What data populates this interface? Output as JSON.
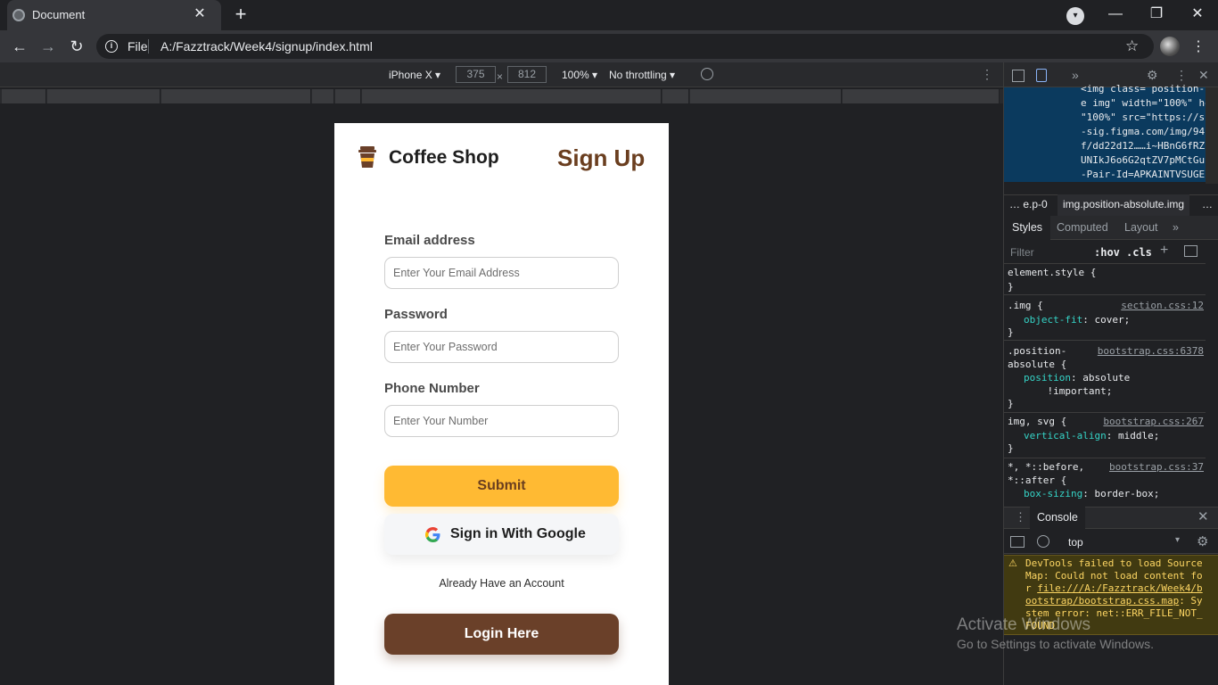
{
  "browser": {
    "tab_title": "Document",
    "tab_close": "✕",
    "new_tab": "+",
    "window_controls": {
      "minimize": "—",
      "restore": "❐",
      "close": "✕"
    },
    "address": {
      "scheme": "File",
      "url": "A:/Fazztrack/Week4/signup/index.html"
    },
    "back": "←",
    "forward": "→",
    "reload": "↻",
    "star": "☆",
    "menu": "⋮"
  },
  "device_toolbar": {
    "device": "iPhone X ▾",
    "width": "375",
    "times": "×",
    "height": "812",
    "zoom": "100% ▾",
    "throttling": "No throttling ▾",
    "menu": "⋮"
  },
  "page": {
    "brand": "Coffee Shop",
    "title": "Sign Up",
    "email_label": "Email address",
    "email_placeholder": "Enter Your Email Address",
    "password_label": "Password",
    "password_placeholder": "Enter Your Password",
    "phone_label": "Phone Number",
    "phone_placeholder": "Enter Your Number",
    "submit": "Submit",
    "google": "Sign in With Google",
    "have_account": "Already Have an Account",
    "login": "Login Here",
    "colors": {
      "accent": "#ffba33",
      "brown": "#6a4029",
      "title_brown": "#6a3e1f"
    }
  },
  "devtools": {
    "more_tabs": "»",
    "close": "✕",
    "elements_code": "<img class= position-\ne img\" width=\"100%\" he\n\"100%\" src=\"https://s\n-sig.figma.com/img/94\nf/dd22d12……i~HBnG6fRZ\nUNIkJ6o6G2qtZV7pMCtGu\n-Pair-Id=APKAINTVSUGE",
    "crumb_more_left": "…",
    "crumb_1": "e.p-0",
    "crumb_2": "img.position-absolute.img",
    "crumb_more_right": "…",
    "tabs": {
      "styles": "Styles",
      "computed": "Computed",
      "layout": "Layout",
      "more": "»"
    },
    "filter_placeholder": "Filter",
    "hov": ":hov",
    "cls": ".cls",
    "plus": "+",
    "rules": [
      {
        "selector": "element.style {",
        "body": "",
        "close": "}",
        "source": ""
      },
      {
        "selector": ".img {",
        "prop": "object-fit",
        "value": ": cover;",
        "close": "}",
        "source": "section.css:12"
      },
      {
        "selector": ".position-\nabsolute {",
        "prop": "position",
        "value": ": absolute\n    !important;",
        "close": "}",
        "source": "bootstrap.css:6378"
      },
      {
        "selector": "img, svg {",
        "prop": "vertical-align",
        "value": ": middle;",
        "close": "}",
        "source": "bootstrap.css:267"
      },
      {
        "selector": "*, *::before,\n*::after {",
        "prop": "box-sizing",
        "value": ": border-box;",
        "close": "",
        "source": "bootstrap.css:37"
      }
    ],
    "console_tab": "Console",
    "console_kebab": "⋮",
    "context": "top",
    "context_caret": "▾",
    "gear": "⚙",
    "warning_icon": "⚠",
    "warning_pre": "DevTools failed to load SourceMap: Could not load content for ",
    "warning_link": "file:///A:/Fazztrack/Week4/bootstrap/bootstrap.css.map",
    "warning_post": ": System error: net::ERR_FILE_NOT_FOUND"
  },
  "watermark": {
    "title": "Activate Windows",
    "subtitle": "Go to Settings to activate Windows."
  }
}
